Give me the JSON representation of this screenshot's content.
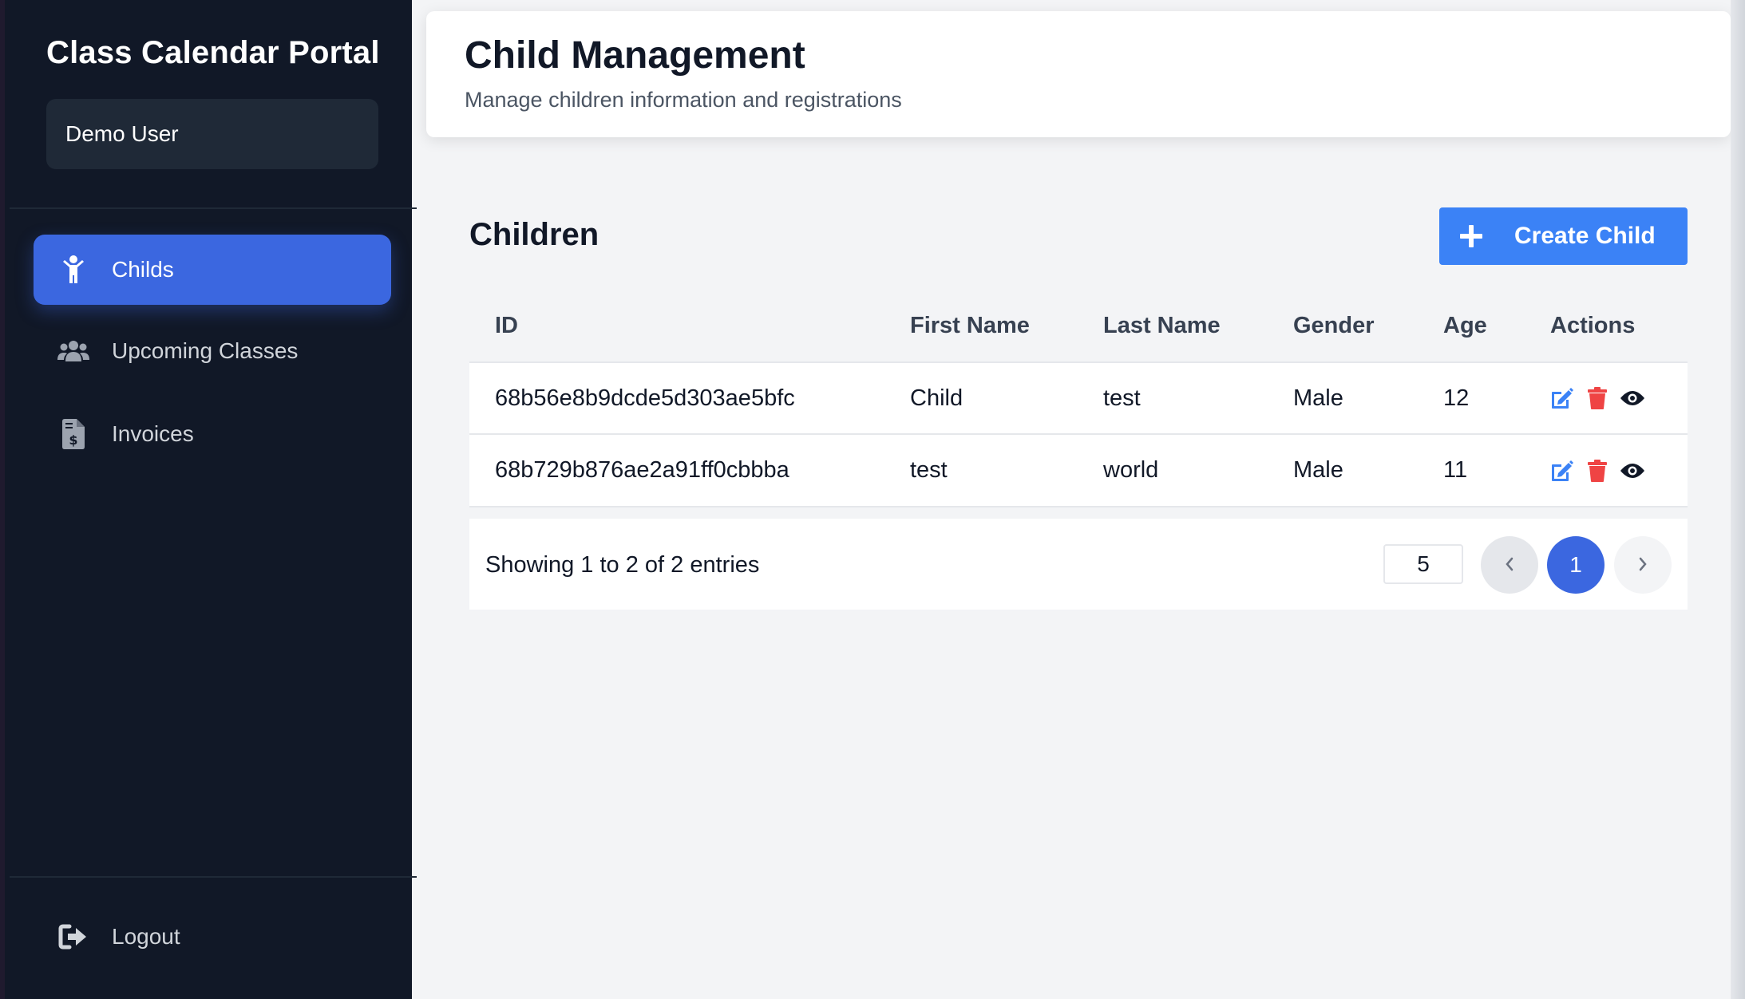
{
  "sidebar": {
    "brand": "Class Calendar Portal",
    "user": "Demo User",
    "items": [
      {
        "label": "Childs",
        "icon": "child-icon",
        "active": true
      },
      {
        "label": "Upcoming Classes",
        "icon": "users-icon",
        "active": false
      },
      {
        "label": "Invoices",
        "icon": "invoice-icon",
        "active": false
      }
    ],
    "logout": {
      "label": "Logout",
      "icon": "logout-icon"
    }
  },
  "header": {
    "title": "Child Management",
    "subtitle": "Manage children information and registrations"
  },
  "main": {
    "section_title": "Children",
    "create_button": "Create Child",
    "table": {
      "columns": [
        "ID",
        "First Name",
        "Last Name",
        "Gender",
        "Age",
        "Actions"
      ],
      "rows": [
        {
          "id": "68b56e8b9dcde5d303ae5bfc",
          "first_name": "Child",
          "last_name": "test",
          "gender": "Male",
          "age": "12"
        },
        {
          "id": "68b729b876ae2a91ff0cbbba",
          "first_name": "test",
          "last_name": "world",
          "gender": "Male",
          "age": "11"
        }
      ]
    },
    "footer": {
      "showing": "Showing 1 to 2 of 2 entries",
      "page_size": "5",
      "current_page": "1"
    }
  },
  "colors": {
    "sidebar_bg": "#111827",
    "accent": "#3b67e0",
    "button": "#3b82f6",
    "edit": "#3b82f6",
    "delete": "#ef4444",
    "view": "#111827"
  }
}
